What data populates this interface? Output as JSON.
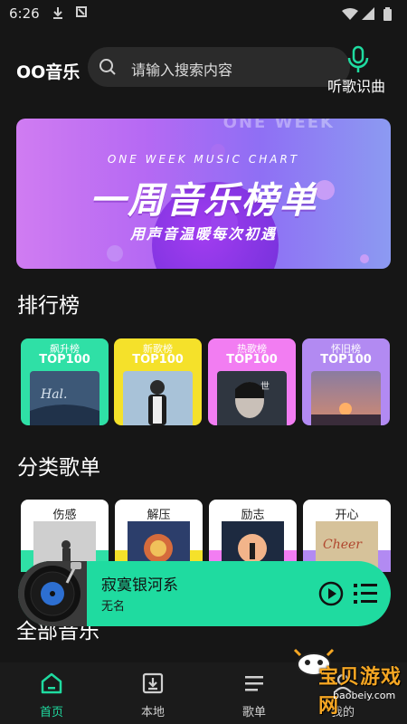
{
  "status_bar": {
    "time": "6:26"
  },
  "header": {
    "app_title": "OO音乐",
    "search_placeholder": "请输入搜索内容",
    "mic_label": "听歌识曲"
  },
  "banner": {
    "english": "ONE WEEK MUSIC CHART",
    "title": "一周音乐榜单",
    "subtitle": "用声音温暖每次初遇",
    "corner_text": "ONE WEEK"
  },
  "ranking": {
    "title": "排行榜",
    "cards": [
      {
        "label": "飙升榜",
        "top": "TOP100",
        "color": "#2fe0a6",
        "art": "#3d5877"
      },
      {
        "label": "新歌榜",
        "top": "TOP100",
        "color": "#f5e12a",
        "art": "#9bb8d0"
      },
      {
        "label": "热歌榜",
        "top": "TOP100",
        "color": "#f27df2",
        "art": "#2f3640"
      },
      {
        "label": "怀旧榜",
        "top": "TOP100",
        "color": "#b28af2",
        "art": "#6b5d7e"
      }
    ]
  },
  "categories": {
    "title": "分类歌单",
    "cards": [
      {
        "label": "伤感",
        "strip": "#2fe0a6",
        "art": "#c8c8c8"
      },
      {
        "label": "解压",
        "strip": "#f5e12a",
        "art": "#2c3e6b"
      },
      {
        "label": "励志",
        "strip": "#f27df2",
        "art": "#1d2a40"
      },
      {
        "label": "开心",
        "strip": "#b28af2",
        "art": "#d6c29a"
      }
    ]
  },
  "all_music": {
    "title": "全部音乐"
  },
  "player": {
    "song": "寂寞银河系",
    "artist": "无名",
    "accent": "#1fdba0"
  },
  "tabbar": {
    "tabs": [
      {
        "label": "首页",
        "icon": "home-icon",
        "active": true
      },
      {
        "label": "本地",
        "icon": "download-icon",
        "active": false
      },
      {
        "label": "歌单",
        "icon": "playlist-icon",
        "active": false
      },
      {
        "label": "我的",
        "icon": "user-icon",
        "active": false
      }
    ]
  },
  "watermark": {
    "title": "宝贝游戏网",
    "url": "baobeiy.com"
  }
}
